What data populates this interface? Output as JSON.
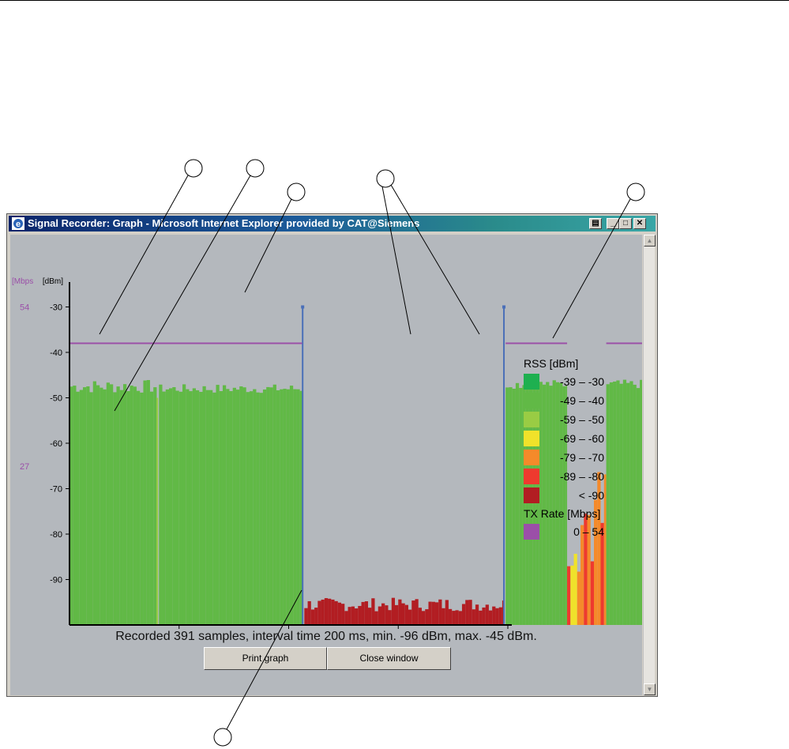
{
  "window": {
    "title": "Signal Recorder: Graph - Microsoft Internet Explorer provided by CAT@Siemens"
  },
  "summary": "Recorded 391 samples, interval time 200 ms, min. -96 dBm, max. -45 dBm.",
  "buttons": {
    "print": "Print graph",
    "close": "Close window"
  },
  "chart_data": {
    "type": "bar",
    "y_unit_label": "[dBm]",
    "y2_unit_label": "[Mbps",
    "y2_ticks": [
      {
        "label": "54",
        "at_dbm": -30
      },
      {
        "label": "27",
        "at_dbm": -65
      }
    ],
    "ylim": [
      -100,
      -28
    ],
    "yticks": [
      -30,
      -40,
      -50,
      -60,
      -70,
      -80,
      -90
    ],
    "xlim": [
      0,
      392
    ],
    "xticks": [
      98,
      196,
      294,
      392
    ],
    "grid": false,
    "rss_segments": [
      {
        "x0": 0,
        "x1": 78,
        "rss_min": -49,
        "rss_max": -46,
        "color": "#61b946"
      },
      {
        "x0": 78,
        "x1": 80,
        "rss_min": -50,
        "rss_max": -50,
        "color": "#99cc44"
      },
      {
        "x0": 80,
        "x1": 208,
        "rss_min": -49,
        "rss_max": -47,
        "color": "#61b946"
      },
      {
        "x0": 208,
        "x1": 210,
        "rss_min": -30,
        "rss_max": -30,
        "color": "#4a6fb8"
      },
      {
        "x0": 210,
        "x1": 388,
        "rss_min": -97,
        "rss_max": -94,
        "color": "#b21d22"
      },
      {
        "x0": 388,
        "x1": 390,
        "rss_min": -30,
        "rss_max": -30,
        "color": "#4a6fb8"
      },
      {
        "x0": 390,
        "x1": 445,
        "rss_min": -48,
        "rss_max": -46,
        "color": "#61b946"
      },
      {
        "x0": 445,
        "x1": 480,
        "rss_min": -89,
        "rss_max": -64,
        "color": "#f0e22a"
      },
      {
        "x0": 480,
        "x1": 525,
        "rss_min": -48,
        "rss_max": -46,
        "color": "#61b946"
      }
    ],
    "tx_rate_segments": [
      {
        "x0": 0,
        "x1": 208,
        "mbps": 54
      },
      {
        "x0": 390,
        "x1": 445,
        "mbps": 54
      },
      {
        "x0": 480,
        "x1": 525,
        "mbps": 54
      }
    ],
    "legend": {
      "rss_title": "RSS [dBm]",
      "rss_entries": [
        {
          "label": "-39 –  -30",
          "color": "#1eb050"
        },
        {
          "label": "-49 –  -40",
          "color": "#61b946"
        },
        {
          "label": "-59 –  -50",
          "color": "#99cc44"
        },
        {
          "label": "-69 –  -60",
          "color": "#f0e22a"
        },
        {
          "label": "-79 –  -70",
          "color": "#f58a2a"
        },
        {
          "label": "-89 –  -80",
          "color": "#ee3a2e"
        },
        {
          "label": "< -90",
          "color": "#b21d22"
        }
      ],
      "tx_title": "TX Rate [Mbps]",
      "tx_entries": [
        {
          "label": "0 –   54",
          "color": "#9b4fa8"
        }
      ],
      "placement": "right"
    }
  }
}
